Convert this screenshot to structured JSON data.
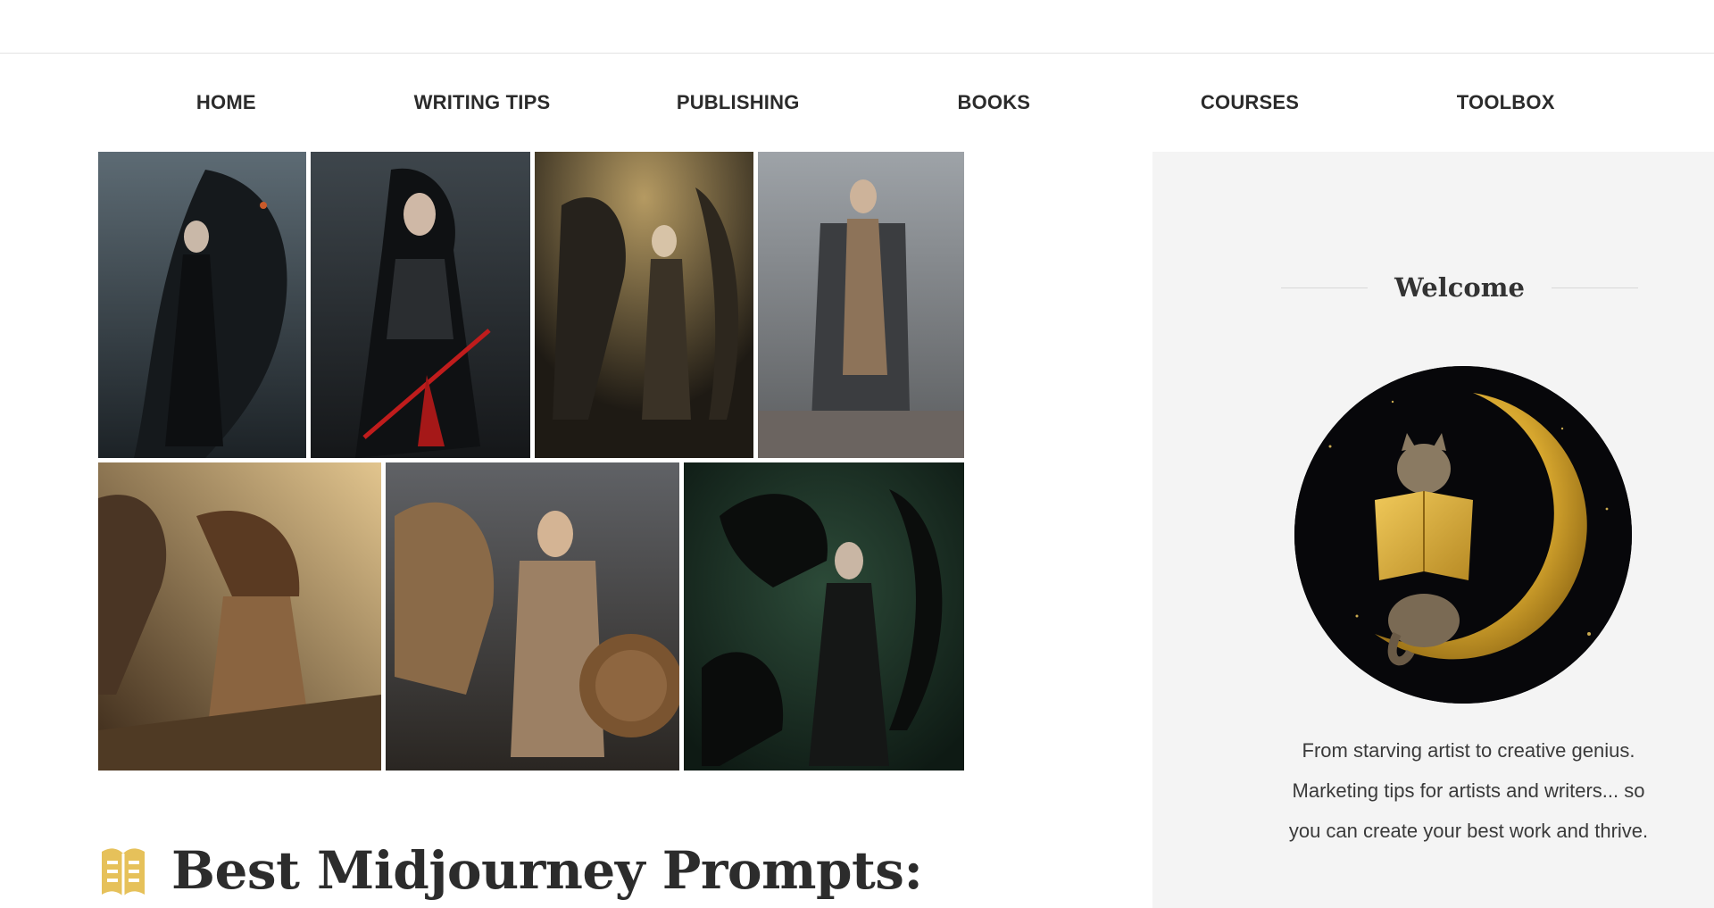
{
  "nav": {
    "items": [
      {
        "label": "HOME"
      },
      {
        "label": "WRITING TIPS"
      },
      {
        "label": "PUBLISHING"
      },
      {
        "label": "BOOKS"
      },
      {
        "label": "COURSES"
      },
      {
        "label": "TOOLBOX"
      }
    ]
  },
  "post": {
    "title": "Best Midjourney Prompts:",
    "icon": "book-icon"
  },
  "sidebar": {
    "widget_title": "Welcome",
    "welcome_text": "From starving artist to creative genius. Marketing tips for artists and writers... so you can create your best work and thrive."
  },
  "colors": {
    "accent": "#e6c15a",
    "sidebar_bg": "#f4f4f4",
    "nav_text": "#2b2b2b"
  }
}
